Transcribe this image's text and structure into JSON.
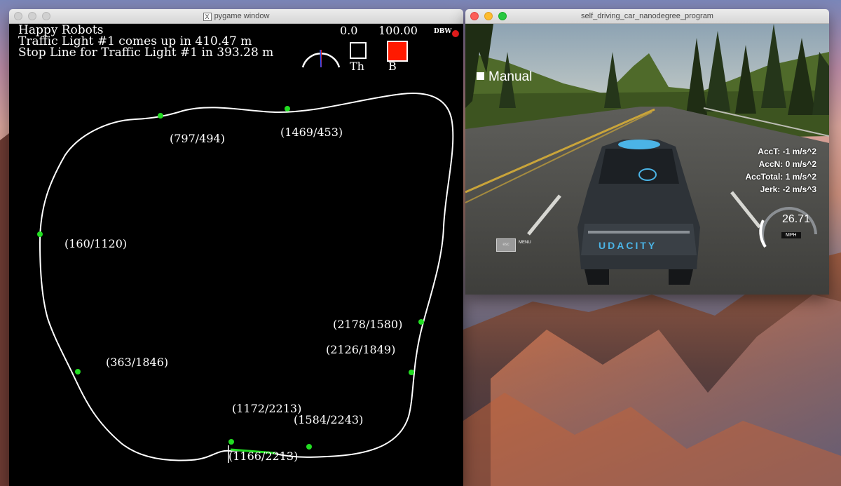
{
  "pygame_window": {
    "title": "pygame window",
    "team_name": "Happy Robots",
    "traffic_light_line": "Traffic Light #1 comes up in 410.47 m",
    "stop_line_line": "Stop Line for Traffic Light #1 in 393.28 m",
    "throttle_value": "0.0",
    "brake_value": "100.00",
    "dbw_label": "DBW",
    "throttle_label": "Th",
    "brake_label": "B",
    "waypoints": [
      {
        "label": "(797/494)"
      },
      {
        "label": "(1469/453)"
      },
      {
        "label": "(160/1120)"
      },
      {
        "label": "(2178/1580)"
      },
      {
        "label": "(2126/1849)"
      },
      {
        "label": "(363/1846)"
      },
      {
        "label": "(1172/2213)"
      },
      {
        "label": "(1584/2243)"
      },
      {
        "label": "(1166/2213)"
      }
    ],
    "colors": {
      "track": "#ffffff",
      "waypoint": "#22dd22",
      "brake": "#ff1a00",
      "dbw_indicator": "#e81c1c"
    }
  },
  "sim_window": {
    "title": "self_driving_car_nanodegree_program",
    "mode_label": "Manual",
    "acc_t": "AccT: -1 m/s^2",
    "acc_n": "AccN: 0 m/s^2",
    "acc_total": "AccTotal: 1 m/s^2",
    "jerk": "Jerk: -2 m/s^3",
    "speed": "26.71",
    "speed_unit": "MPH",
    "esc_label": "esc",
    "menu_label": "MENU",
    "car_brand": "UDACITY"
  }
}
